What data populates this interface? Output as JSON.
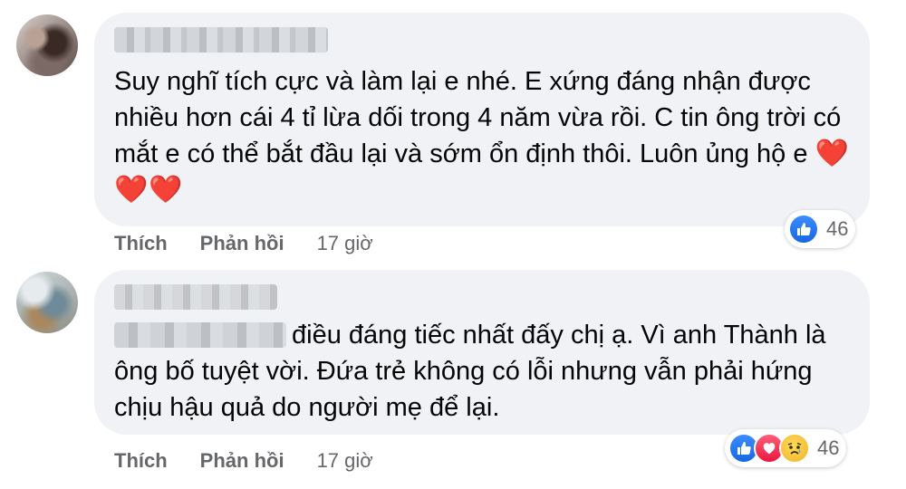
{
  "comments": [
    {
      "text": "Suy nghĩ tích cực và làm lại e nhé. E xứng đáng nhận được nhiều hơn cái 4 tỉ lừa dối trong 4 năm vừa rồi. C tin ông trời có mắt e có thể bắt đầu lại và sớm ổn định thôi. Luôn ủng hộ e",
      "emoji": "❤️❤️❤️",
      "actions": {
        "like": "Thích",
        "reply": "Phản hồi",
        "time": "17 giờ"
      },
      "reactions": {
        "icons": [
          "like-icon"
        ],
        "count": "46"
      }
    },
    {
      "text": "điều đáng tiếc nhất đấy chị ạ. Vì anh Thành là ông bố tuyệt vời. Đứa trẻ không có lỗi nhưng vẫn phải hứng chịu hậu quả do người mẹ để lại.",
      "actions": {
        "like": "Thích",
        "reply": "Phản hồi",
        "time": "17 giờ"
      },
      "reactions": {
        "icons": [
          "like-icon",
          "love-icon",
          "sad-icon"
        ],
        "count": "46"
      }
    }
  ],
  "colors": {
    "bubble": "#f0f2f5",
    "meta": "#65676b",
    "like": "#1877f2",
    "love": "#e8173d",
    "sad": "#f7b125"
  }
}
